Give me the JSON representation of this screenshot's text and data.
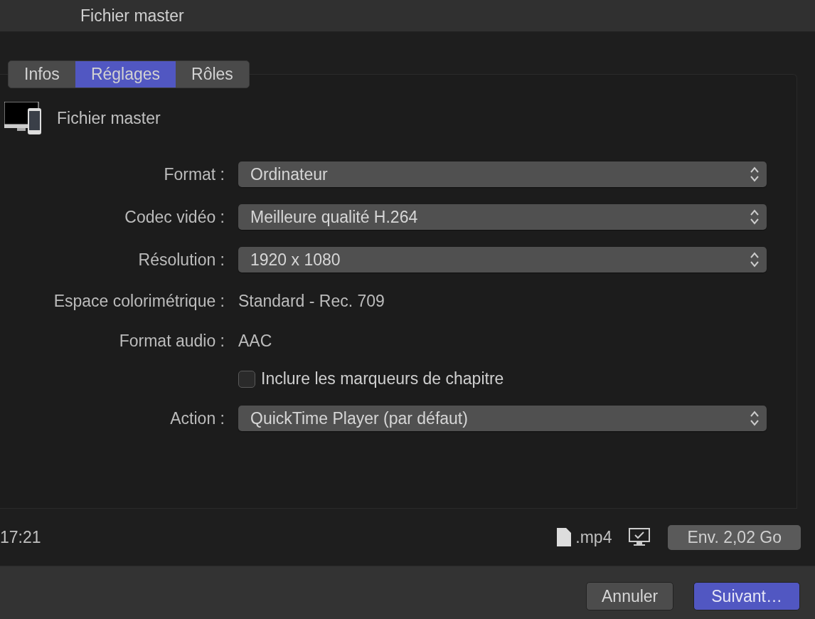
{
  "window": {
    "title": "Fichier master"
  },
  "tabs": [
    {
      "label": "Infos",
      "selected": false
    },
    {
      "label": "Réglages",
      "selected": true
    },
    {
      "label": "Rôles",
      "selected": false
    }
  ],
  "destination": {
    "name": "Fichier master"
  },
  "fields": [
    {
      "kind": "popup",
      "label": "Format :",
      "value": "Ordinateur"
    },
    {
      "kind": "popup",
      "label": "Codec vidéo :",
      "value": "Meilleure qualité H.264"
    },
    {
      "kind": "popup",
      "label": "Résolution :",
      "value": "1920 x 1080"
    },
    {
      "kind": "text",
      "label": "Espace colorimétrique :",
      "value": "Standard - Rec. 709"
    },
    {
      "kind": "text",
      "label": "Format audio :",
      "value": "AAC"
    },
    {
      "kind": "checkbox",
      "label": "Inclure les marqueurs de chapitre",
      "checked": false
    },
    {
      "kind": "popup",
      "label": "Action :",
      "value": "QuickTime Player (par défaut)"
    }
  ],
  "info_bar": {
    "duration": "17:21",
    "extension": ".mp4",
    "size": "Env. 2,02 Go"
  },
  "buttons": [
    {
      "label": "Annuler",
      "primary": false
    },
    {
      "label": "Suivant…",
      "primary": true
    }
  ]
}
